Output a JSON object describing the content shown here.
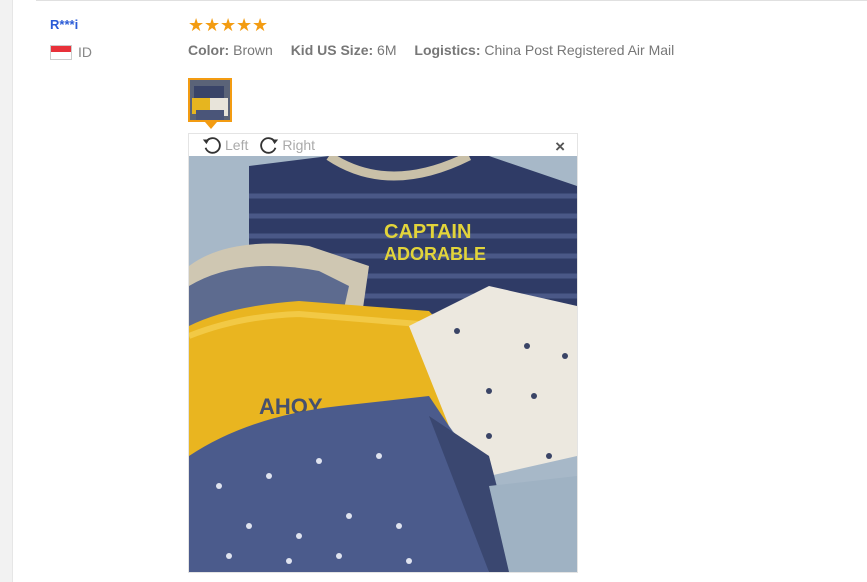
{
  "review": {
    "buyer_name": "R***i",
    "country_code": "ID",
    "rating": 5,
    "star_glyph": "★",
    "attributes": [
      {
        "key": "Color:",
        "value": "Brown"
      },
      {
        "key": "Kid US Size:",
        "value": "6M"
      },
      {
        "key": "Logistics:",
        "value": "China Post Registered Air Mail"
      }
    ]
  },
  "viewer": {
    "rotate_left_label": "Left",
    "rotate_right_label": "Right",
    "close_glyph": "×",
    "photo_text_1": "CAPTAIN",
    "photo_text_2": "ADORABLE",
    "photo_text_3": "AHOY"
  },
  "colors": {
    "accent_orange": "#f39c12",
    "buyer_link": "#2a5bd7"
  },
  "icons": [
    "flag-icon",
    "star-icon",
    "rotate-left-icon",
    "rotate-right-icon",
    "close-icon"
  ]
}
